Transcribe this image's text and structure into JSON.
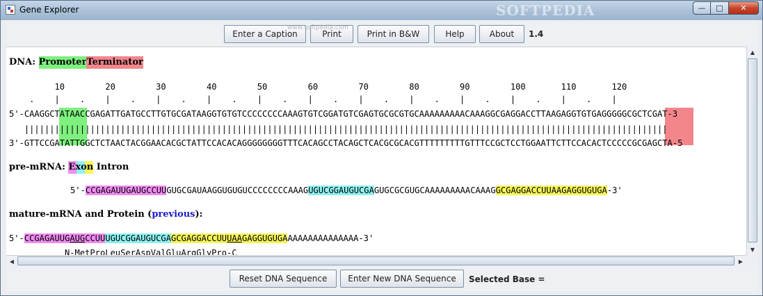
{
  "window": {
    "title": "Gene Explorer",
    "watermark": "SOFTPEDIA"
  },
  "toolbar": {
    "buttons": [
      {
        "label": "Enter a Caption"
      },
      {
        "label": "Print"
      },
      {
        "label": "Print in B&W"
      },
      {
        "label": "Help"
      },
      {
        "label": "About"
      }
    ],
    "version": "1.4",
    "softpedia": "www.softpedia.com"
  },
  "dna": {
    "heading": "DNA:",
    "legend_promoter": "Promoter",
    "legend_terminator": "Terminator",
    "ruler_numbers": "         10        20        30        40        50        60        70        80        90        100       110       120",
    "ruler_marks": "    .    |    .    |    .    |    .    |    .    |    .    |    .    |    .    |    .    |    .    |    .    |    .    |",
    "top_strand": "5'-CAAGGCTATAACCGAGATTGATGCCTTGTGCGATAAGGTGTGTCCCCCCCCAAAGTGTCGGATGTCGAGTGCGCGTGCAAAAAAAAACAAAGGCGAGGACCTTAAGAGGTGTGAGGGGGCGCTCGAT-3",
    "bonds": "   |||||||||||||||||||||||||||||||||||||||||||||||||||||||||||||||||||||||||||||||||||||||||||||||||||||||||||||||||||||||||||||||",
    "bottom_strand": "3'-GTTCCGATATTGGCTCTAACTACGGAACACGCTATTCCACACAGGGGGGGGTTTCACAGCCTACAGCTCACGCGCACGTTTTTTTTTGTTTCCGCTCCTGGAATTCTTCCACACTCCCCCGCGAGCTA-5"
  },
  "premrna": {
    "heading": "pre-mRNA:",
    "legend_exon": "Exon",
    "legend_intron": "Intron",
    "seq_prefix": "5'-",
    "exon1": "CCGAGAUUGAUGCCUU",
    "intron1": "GUGCGAUAAGGUGUGUCCCCCCCCAAAG",
    "exon2": "UGUCGGAUGUCGA",
    "intron2": "GUGCGCGUGCAAAAAAAAACAAAG",
    "exon3": "GCGAGGACCUUAAGAGGUGUGA",
    "seq_suffix": "-3'"
  },
  "mature": {
    "heading": "mature-mRNA and Protein (",
    "link": "previous",
    "heading_end": "):",
    "seq_prefix": "5'-",
    "e1a": "CCGAGAUUG",
    "e1b": "AUG",
    "e1c": "CCUU",
    "e2": "UGUCGGAUGUCGA",
    "e3a": "GCGAGGACCUU",
    "e3b": "UAA",
    "e3c": "GAGGUGUGA",
    "tail": "AAAAAAAAAAAAAA-3'",
    "protein": "N-MetProLeuSerAspValGluArgGlyPro-C"
  },
  "bottom": {
    "reset_label": "Reset DNA Sequence",
    "new_label": "Enter New DNA Sequence",
    "selected_base": "Selected Base ="
  },
  "colors": {
    "promoter": "#7ef07e",
    "terminator": "#f2868b",
    "exon1": "#f08cf0",
    "exon2": "#8ff2f2",
    "exon3": "#f5f55a"
  }
}
